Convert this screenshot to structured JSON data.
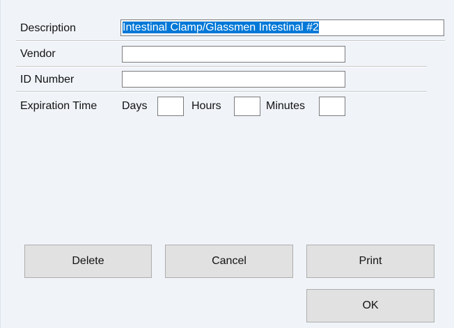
{
  "form": {
    "description": {
      "label": "Description",
      "value": "Intestinal Clamp/Glassmen Intestinal #2"
    },
    "vendor": {
      "label": "Vendor",
      "value": ""
    },
    "id_number": {
      "label": "ID Number",
      "value": ""
    },
    "expiration": {
      "label": "Expiration Time",
      "days_label": "Days",
      "days_value": "",
      "hours_label": "Hours",
      "hours_value": "",
      "minutes_label": "Minutes",
      "minutes_value": ""
    }
  },
  "buttons": {
    "delete_label": "Delete",
    "cancel_label": "Cancel",
    "print_label": "Print",
    "ok_label": "OK"
  },
  "colors": {
    "background": "#f0f4f9",
    "selection": "#0078d7",
    "button_face": "#e1e1e1"
  }
}
